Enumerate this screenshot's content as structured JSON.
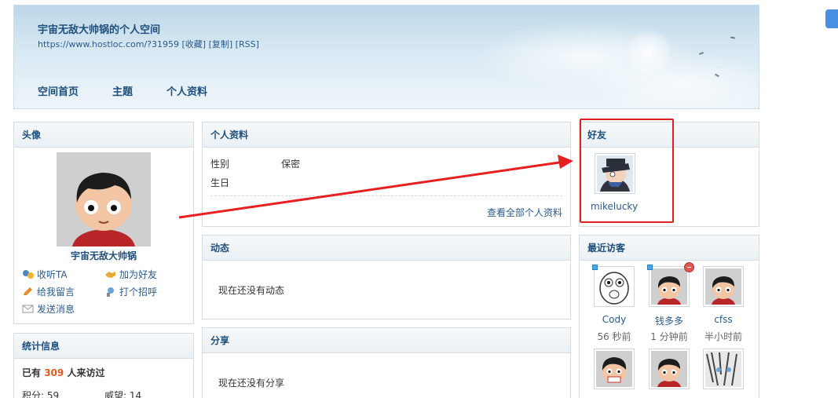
{
  "header": {
    "site_title": "宇宙无敌大帅锅的个人空间",
    "url_line": "https://www.hostloc.com/?31959 [收藏] [复制] [RSS]",
    "nav": [
      "空间首页",
      "主题",
      "个人资料"
    ]
  },
  "avatar_panel": {
    "title": "头像",
    "username": "宇宙无敌大帅锅",
    "actions": [
      {
        "label": "收听TA",
        "icon": "follow-icon"
      },
      {
        "label": "加为好友",
        "icon": "handshake-icon"
      },
      {
        "label": "给我留言",
        "icon": "pencil-icon"
      },
      {
        "label": "打个招呼",
        "icon": "poke-icon"
      },
      {
        "label": "发送消息",
        "icon": "envelope-icon"
      }
    ]
  },
  "stats_panel": {
    "title": "统计信息",
    "visits_prefix": "已有",
    "visits_count": "309",
    "visits_suffix": "人来访过",
    "points_label": "积分: 59",
    "prestige_label": "威望: 14"
  },
  "profile_panel": {
    "title": "个人资料",
    "fields": [
      {
        "label": "性别",
        "value": "保密"
      },
      {
        "label": "生日",
        "value": ""
      }
    ],
    "view_all": "查看全部个人资料"
  },
  "activity_panel": {
    "title": "动态",
    "empty": "现在还没有动态"
  },
  "share_panel": {
    "title": "分享",
    "empty": "现在还没有分享"
  },
  "friends_panel": {
    "title": "好友",
    "friends": [
      {
        "name": "mikelucky"
      }
    ]
  },
  "visitors_panel": {
    "title": "最近访客",
    "visitors": [
      {
        "name": "Cody",
        "time": "56 秒前"
      },
      {
        "name": "钱多多",
        "time": "1 分钟前"
      },
      {
        "name": "cfss",
        "time": "半小时前"
      }
    ]
  },
  "colors": {
    "accent": "#1f4f7c",
    "link": "#2b5b8a",
    "highlight": "#e02020",
    "count": "#e05a1c"
  }
}
